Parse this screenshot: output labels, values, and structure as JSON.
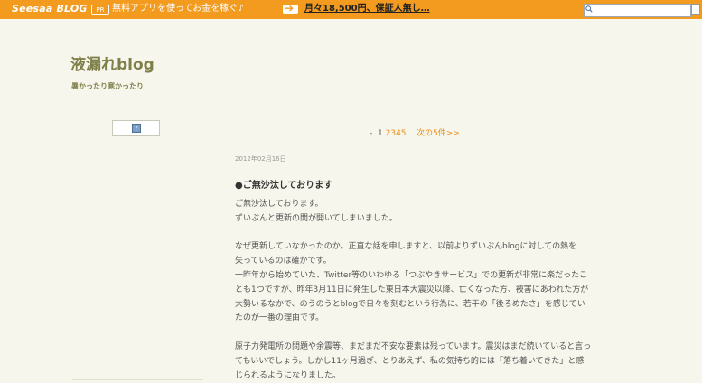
{
  "topbar": {
    "logo": "Seesaa BLOG",
    "pr_badge": "PR",
    "pr_text": "無料アプリを使ってお金を稼ぐ♪",
    "promo_link": "月々18,500円、保証人無し…",
    "search_placeholder": ""
  },
  "header": {
    "title": "液漏れblog",
    "subtitle": "暑かったり寒かったり"
  },
  "sidebar": {
    "widget_icon": "?"
  },
  "pager": {
    "prefix": "-",
    "current": "1",
    "pages": [
      "2",
      "3",
      "4",
      "5"
    ],
    "ellipsis": "..",
    "next": "次の5件>>"
  },
  "post": {
    "date": "2012年02月16日",
    "title": "●ご無沙汰しております",
    "body": [
      "ご無沙汰しております。",
      "ずいぶんと更新の間が開いてしまいました。",
      "",
      "なぜ更新していなかったのか。正直な話を申しますと、以前よりずいぶんblogに対しての熱を",
      "失っているのは確かです。",
      "一昨年から始めていた、Twitter等のいわゆる「つぶやきサービス」での更新が非常に楽だったこ",
      "とも1つですが、昨年3月11日に発生した東日本大震災以降、亡くなった方、被害にあわれた方が",
      "大勢いるなかで、のうのうとblogで日々を刻むという行為に、若干の「後ろめたさ」を感じてい",
      "たのが一番の理由です。",
      "",
      "原子力発電所の問題や余震等、まだまだ不安な要素は残っています。震災はまだ続いていると言っ",
      "てもいいでしょう。しかし11ヶ月過ぎ、とりあえず、私の気持ち的には「落ち着いてきた」と感",
      "じられるようになりました。"
    ]
  },
  "colors": {
    "topbar": "#f29b1f",
    "background": "#f6f6ec",
    "title": "#7f7f4a",
    "link": "#e98f18"
  }
}
